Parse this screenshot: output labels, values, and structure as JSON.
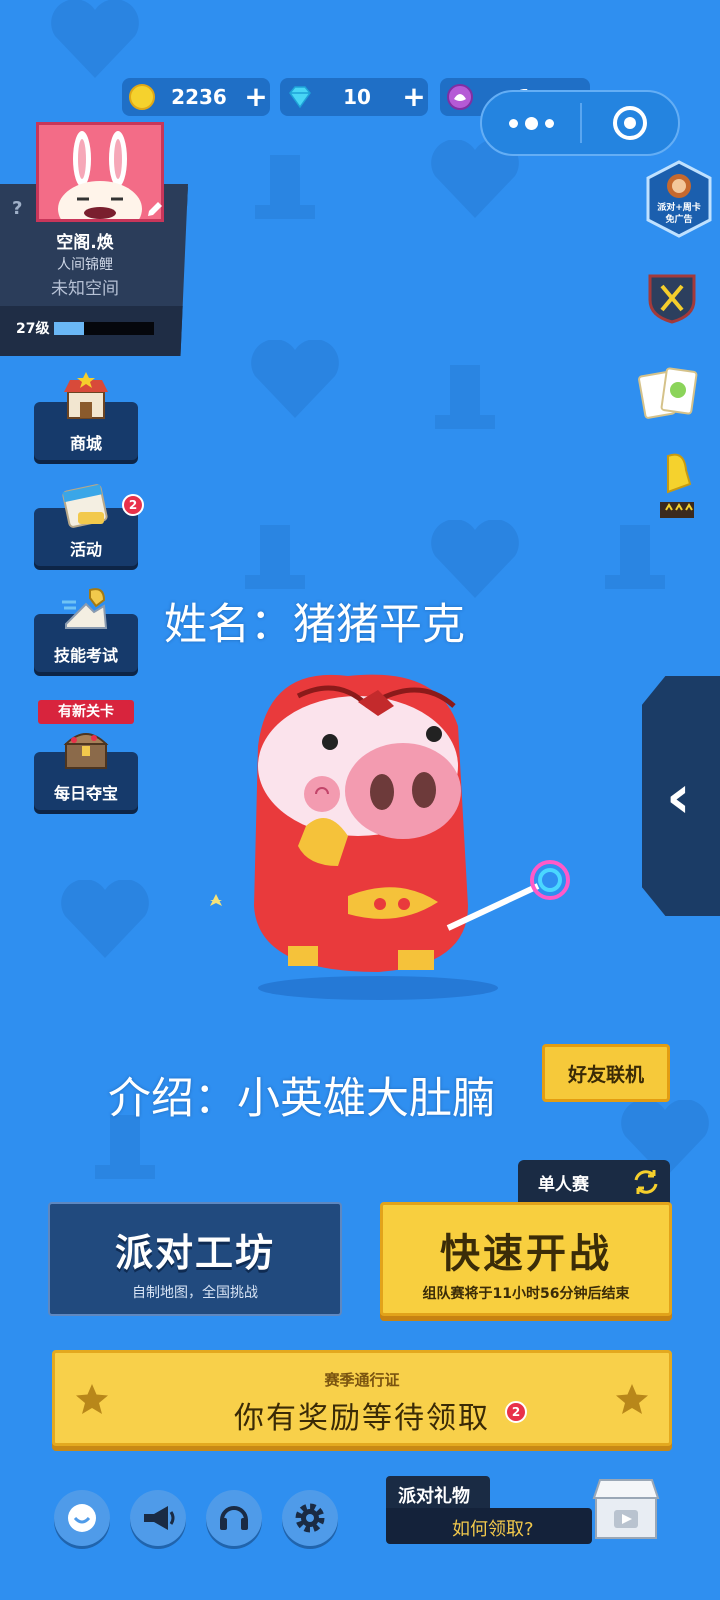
{
  "resources": {
    "coins": "2236",
    "gems": "10",
    "tickets": "1",
    "coin_icon": "coin-icon",
    "gem_icon": "diamond-icon",
    "ticket_icon": "party-ticket-icon"
  },
  "profile": {
    "help": "?",
    "name": "空阁.焕",
    "title": "人间锦鲤",
    "space": "未知空间",
    "level": "27级",
    "xp_fraction": 0.3
  },
  "left_menu": [
    {
      "label": "商城",
      "icon": "shop-icon"
    },
    {
      "label": "活动",
      "icon": "calendar-icon",
      "badge": "2"
    },
    {
      "label": "技能考试",
      "icon": "skill-exam-icon"
    },
    {
      "label": "每日夺宝",
      "icon": "treasure-chest-icon",
      "tag": "有新关卡"
    }
  ],
  "right_icons": {
    "promo_text_1": "派对+周卡",
    "promo_text_2": "免广告"
  },
  "captions": {
    "name": "姓名：猪猪平克",
    "intro": "介绍：小英雄大肚腩"
  },
  "buttons": {
    "friend": "好友联机",
    "solo": "单人赛",
    "workshop_title": "派对工坊",
    "workshop_sub": "自制地图，全国挑战",
    "quick_title": "快速开战",
    "quick_sub": "组队赛将于11小时56分钟后结束"
  },
  "season_pass": {
    "title": "赛季通行证",
    "message": "你有奖励等待领取",
    "badge": "2"
  },
  "gift": {
    "title": "派对礼物",
    "link": "如何领取?"
  },
  "colors": {
    "background": "#2f8ff0",
    "yellow_button": "#f8cf3f",
    "dark_panel": "#1a2b44"
  }
}
